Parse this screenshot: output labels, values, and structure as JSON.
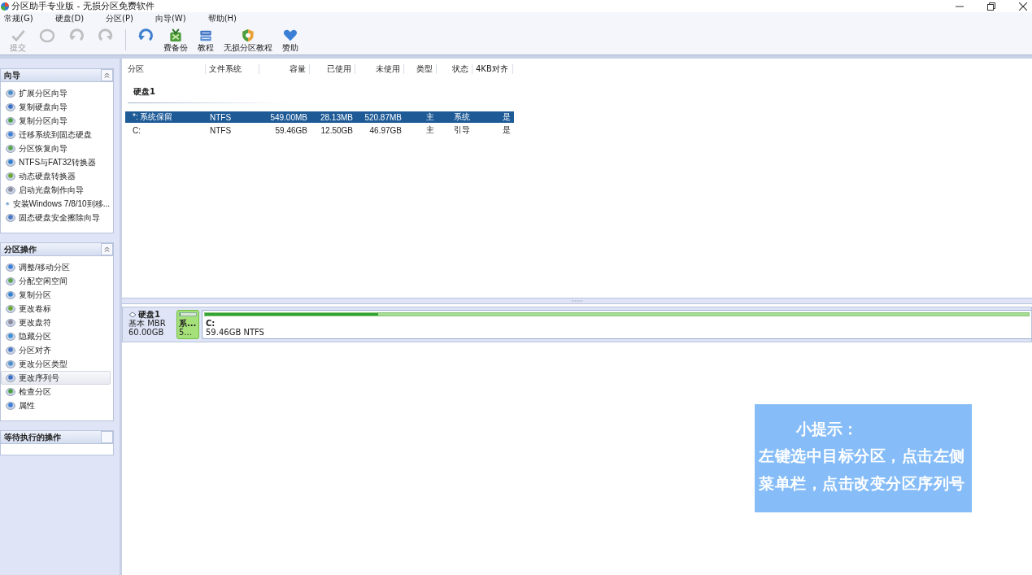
{
  "window": {
    "title": "分区助手专业版 - 无损分区免费软件"
  },
  "menu": [
    "常规(G)",
    "硬盘(D)",
    "分区(P)",
    "向导(W)",
    "帮助(H)"
  ],
  "toolbar": [
    {
      "label": "提交",
      "disabled": true
    },
    {
      "disabled": true
    },
    {
      "disabled": true
    },
    {
      "disabled": true
    },
    {
      "disabled": false
    },
    {
      "label": "费备份",
      "disabled": false
    },
    {
      "label": "教程",
      "disabled": false
    },
    {
      "label": "无损分区教程",
      "disabled": false
    },
    {
      "label": "赞助",
      "disabled": false
    }
  ],
  "sidebar": {
    "sections": [
      {
        "title": "向导",
        "expanded": true,
        "items": [
          {
            "label": "扩展分区向导",
            "selected": false
          },
          {
            "label": "复制硬盘向导",
            "selected": false
          },
          {
            "label": "复制分区向导",
            "selected": false
          },
          {
            "label": "迁移系统到固态硬盘",
            "selected": false
          },
          {
            "label": "分区恢复向导",
            "selected": false
          },
          {
            "label": "NTFS与FAT32转换器",
            "selected": false
          },
          {
            "label": "动态硬盘转换器",
            "selected": false
          },
          {
            "label": "启动光盘制作向导",
            "selected": false
          },
          {
            "label": "安装Windows 7/8/10到移...",
            "selected": false
          },
          {
            "label": "固态硬盘安全擦除向导",
            "selected": false
          }
        ]
      },
      {
        "title": "分区操作",
        "expanded": true,
        "items": [
          {
            "label": "调整/移动分区",
            "selected": false
          },
          {
            "label": "分配空闲空间",
            "selected": false
          },
          {
            "label": "复制分区",
            "selected": false
          },
          {
            "label": "更改卷标",
            "selected": false
          },
          {
            "label": "更改盘符",
            "selected": false
          },
          {
            "label": "隐藏分区",
            "selected": false
          },
          {
            "label": "分区对齐",
            "selected": false
          },
          {
            "label": "更改分区类型",
            "selected": false
          },
          {
            "label": "更改序列号",
            "selected": true
          },
          {
            "label": "检查分区",
            "selected": false
          },
          {
            "label": "属性",
            "selected": false
          }
        ]
      },
      {
        "title": "等待执行的操作",
        "expanded": false
      }
    ]
  },
  "table": {
    "columns": [
      "分区",
      "文件系统",
      "容量",
      "已使用",
      "未使用",
      "类型",
      "状态",
      "4KB对齐"
    ],
    "disk": "硬盘1",
    "rows": [
      {
        "cells": [
          "*: 系统保留",
          "NTFS",
          "549.00MB",
          "28.13MB",
          "520.87MB",
          "主",
          "系统",
          "是"
        ],
        "selected": true
      },
      {
        "cells": [
          "C:",
          "NTFS",
          "59.46GB",
          "12.50GB",
          "46.97GB",
          "主",
          "引导",
          "是"
        ],
        "selected": false
      }
    ]
  },
  "disk_map": {
    "name": "硬盘1",
    "type": "基本 MBR",
    "size": "60.00GB",
    "partitions": [
      {
        "label": "系...",
        "detail": "5...",
        "level": 0.05,
        "selected": true
      },
      {
        "label": "C:",
        "detail": "59.46GB NTFS",
        "level": 0.21,
        "selected": false
      }
    ]
  },
  "tip": {
    "title": "小提示：",
    "lines": [
      "左键选中目标分区，点击左侧",
      "菜单栏，点击改变分区序列号"
    ]
  }
}
